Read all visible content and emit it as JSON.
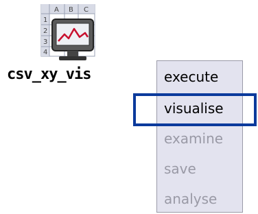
{
  "node": {
    "label": "csv_xy_vis",
    "icon": "spreadsheet-monitor-chart-icon",
    "columns": [
      "A",
      "B",
      "C"
    ],
    "rows": [
      "1",
      "2",
      "3",
      "4"
    ]
  },
  "context_menu": {
    "items": [
      {
        "label": "execute",
        "enabled": true
      },
      {
        "label": "visualise",
        "enabled": true,
        "highlighted": true
      },
      {
        "label": "examine",
        "enabled": false
      },
      {
        "label": "save",
        "enabled": false
      },
      {
        "label": "analyse",
        "enabled": false
      }
    ]
  },
  "colors": {
    "menu_background": "#e3e3ef",
    "highlight_border": "#0b3a9c",
    "disabled_text": "#9a9aa6",
    "chart_line": "#c8102e"
  }
}
